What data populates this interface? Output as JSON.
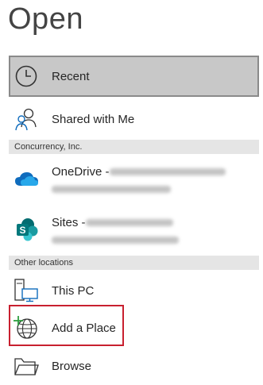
{
  "page": {
    "title": "Open"
  },
  "items": {
    "recent": {
      "label": "Recent",
      "icon": "clock-icon"
    },
    "shared": {
      "label": "Shared with Me",
      "icon": "people-icon"
    },
    "onedrive": {
      "label": "OneDrive - ",
      "icon": "onedrive-cloud-icon"
    },
    "sites": {
      "label": "Sites - ",
      "icon": "sharepoint-icon"
    },
    "thispc": {
      "label": "This PC",
      "icon": "computer-icon"
    },
    "addplace": {
      "label": "Add a Place",
      "icon": "globe-plus-icon"
    },
    "browse": {
      "label": "Browse",
      "icon": "folder-icon"
    }
  },
  "sections": {
    "org": "Concurrency, Inc.",
    "other": "Other locations"
  },
  "colors": {
    "selected_bg": "#c8c8c8",
    "selected_border": "#8a8a8a",
    "section_bg": "#e5e5e5",
    "highlight_border": "#c8202f",
    "onedrive_blue": "#0f6cbd",
    "sharepoint_teal": "#036c70"
  }
}
